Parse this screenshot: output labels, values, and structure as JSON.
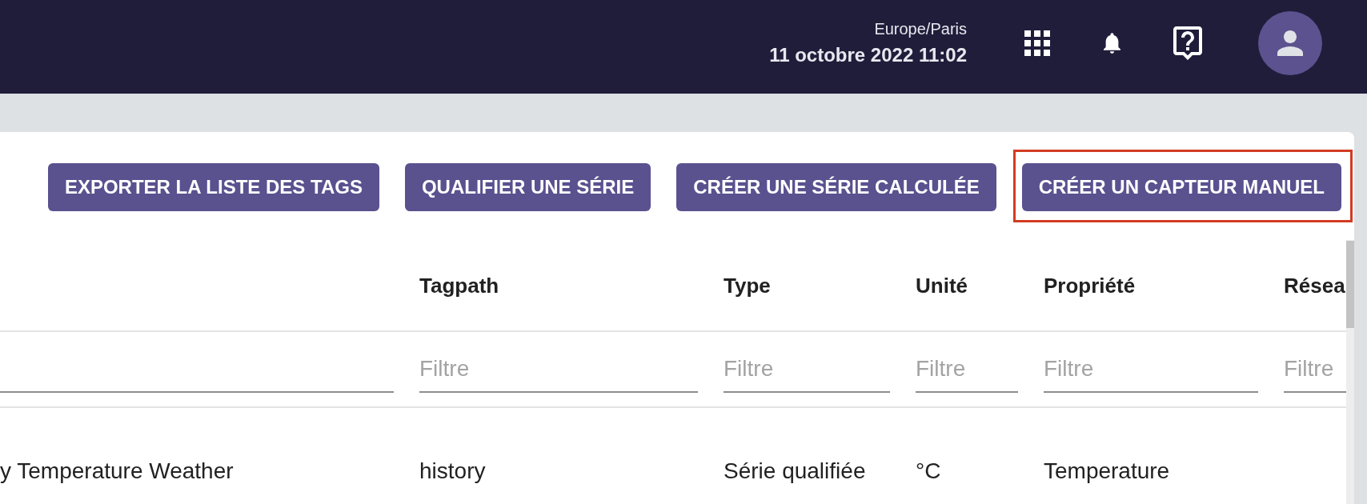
{
  "top_bar": {
    "timezone": "Europe/Paris",
    "datetime": "11 octobre 2022 11:02"
  },
  "toolbar": {
    "buttons": [
      {
        "label": "EXPORTER LA LISTE DES TAGS",
        "highlighted": false
      },
      {
        "label": "QUALIFIER UNE SÉRIE",
        "highlighted": false
      },
      {
        "label": "CRÉER UNE SÉRIE CALCULÉE",
        "highlighted": false
      },
      {
        "label": "CRÉER UN CAPTEUR MANUEL",
        "highlighted": true
      }
    ]
  },
  "table": {
    "columns": [
      {},
      {
        "header": "Tagpath",
        "filter_placeholder": "Filtre"
      },
      {
        "header": "Type",
        "filter_placeholder": "Filtre"
      },
      {
        "header": "Unité",
        "filter_placeholder": "Filtre"
      },
      {
        "header": "Propriété",
        "filter_placeholder": "Filtre"
      },
      {
        "header": "Résea",
        "filter_placeholder": "Filtre"
      }
    ],
    "rows": [
      {
        "cells": [
          "y Temperature Weather",
          "history",
          "Série qualifiée",
          "°C",
          "Temperature"
        ]
      }
    ]
  }
}
